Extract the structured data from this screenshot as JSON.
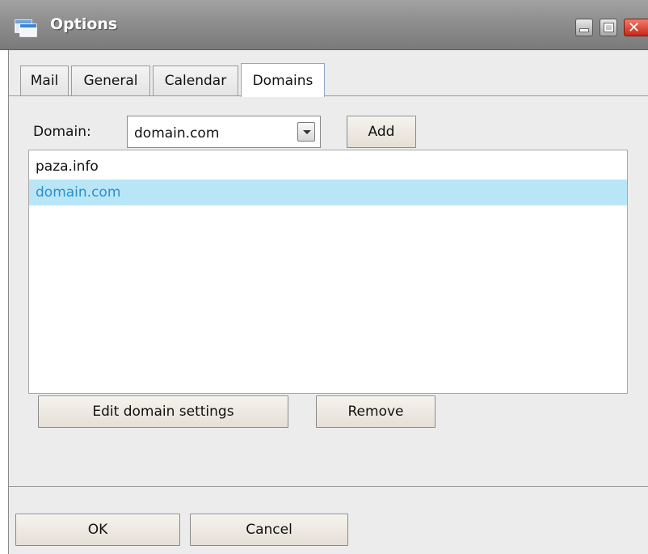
{
  "window": {
    "title": "Options",
    "app_icon": "windows-icon",
    "controls": {
      "minimize_icon": "minimize-icon",
      "maximize_icon": "maximize-icon",
      "close_icon": "close-icon",
      "close_glyph": "✕"
    }
  },
  "tabs": [
    {
      "label": "Mail",
      "active": false
    },
    {
      "label": "General",
      "active": false
    },
    {
      "label": "Calendar",
      "active": false
    },
    {
      "label": "Domains",
      "active": true
    }
  ],
  "domain_selector": {
    "label": "Domain:",
    "value": "domain.com",
    "dropdown_icon": "chevron-down-icon",
    "add_label": "Add"
  },
  "domain_list": {
    "items": [
      {
        "label": "paza.info",
        "selected": false
      },
      {
        "label": "domain.com",
        "selected": true
      }
    ]
  },
  "actions": {
    "edit_label": "Edit domain settings",
    "remove_label": "Remove"
  },
  "footer": {
    "ok_label": "OK",
    "cancel_label": "Cancel"
  },
  "colors": {
    "selection_background": "#b9e6f7",
    "selection_text": "#2a8fcc",
    "close_button": "#d9362a"
  }
}
